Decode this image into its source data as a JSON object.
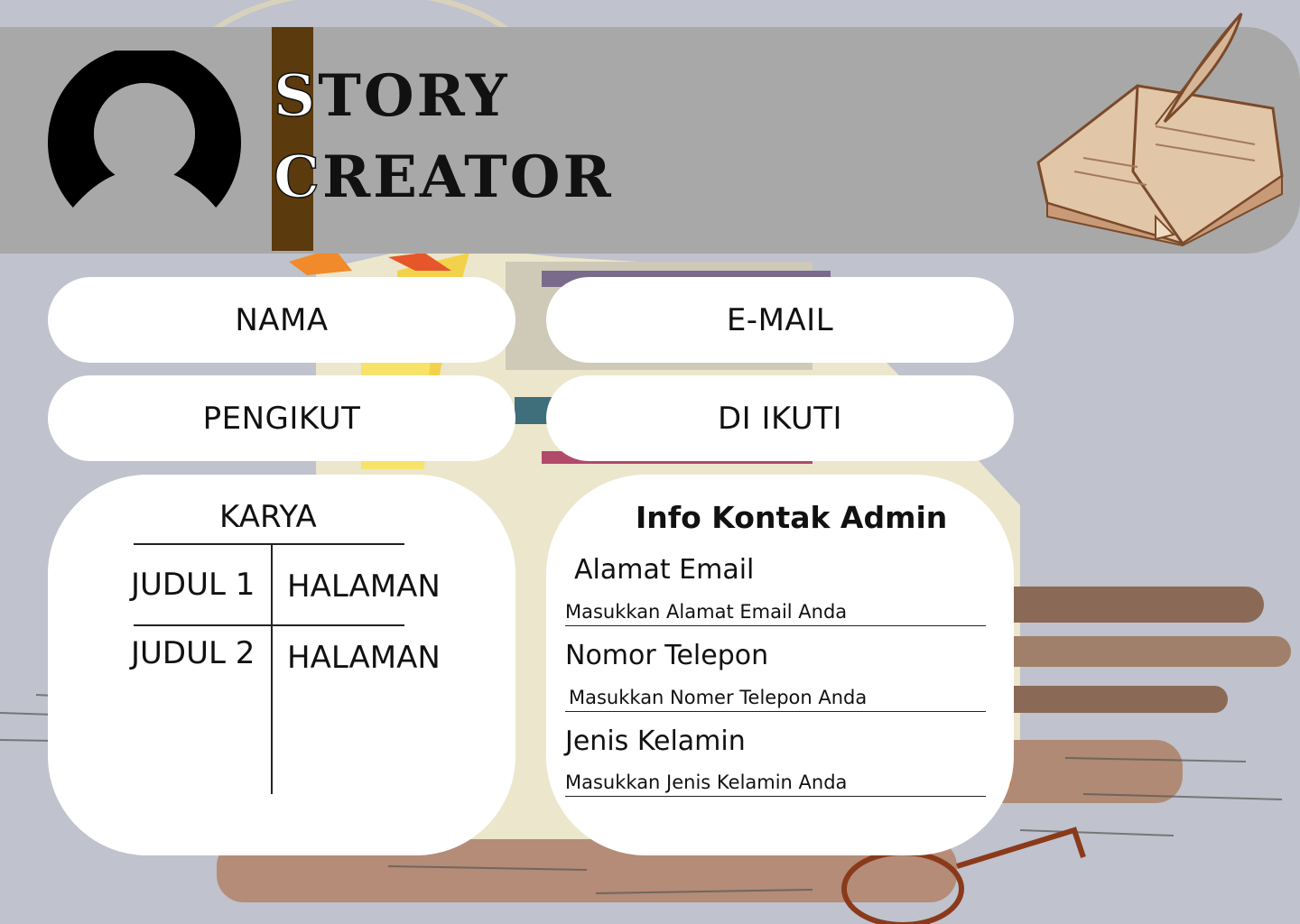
{
  "header": {
    "title_line1_cap": "S",
    "title_line1_rest": "TORY",
    "title_line2_cap": "C",
    "title_line2_rest": "REATOR",
    "avatar_icon": "user-avatar-icon",
    "book_icon": "quill-book-icon"
  },
  "profile": {
    "name_label": "NAMA",
    "email_label": "E-MAIL",
    "followers_label": "PENGIKUT",
    "following_label": "DI IKUTI"
  },
  "works": {
    "title": "KARYA",
    "rows": [
      {
        "title": "JUDUL 1",
        "pages": "HALAMAN"
      },
      {
        "title": "JUDUL 2",
        "pages": "HALAMAN"
      }
    ]
  },
  "admin_contact": {
    "title": "Info Kontak Admin",
    "email_label": "Alamat Email",
    "email_placeholder": "Masukkan Alamat Email Anda",
    "phone_label": "Nomor Telepon",
    "phone_placeholder": "Masukkan Nomer Telepon Anda",
    "gender_label": "Jenis Kelamin",
    "gender_placeholder": "Masukkan Jenis Kelamin Anda"
  },
  "colors": {
    "background": "#c0c2cd",
    "header": "#a8a8a8",
    "title_accent": "#5b3a0e",
    "card": "#ffffff"
  }
}
